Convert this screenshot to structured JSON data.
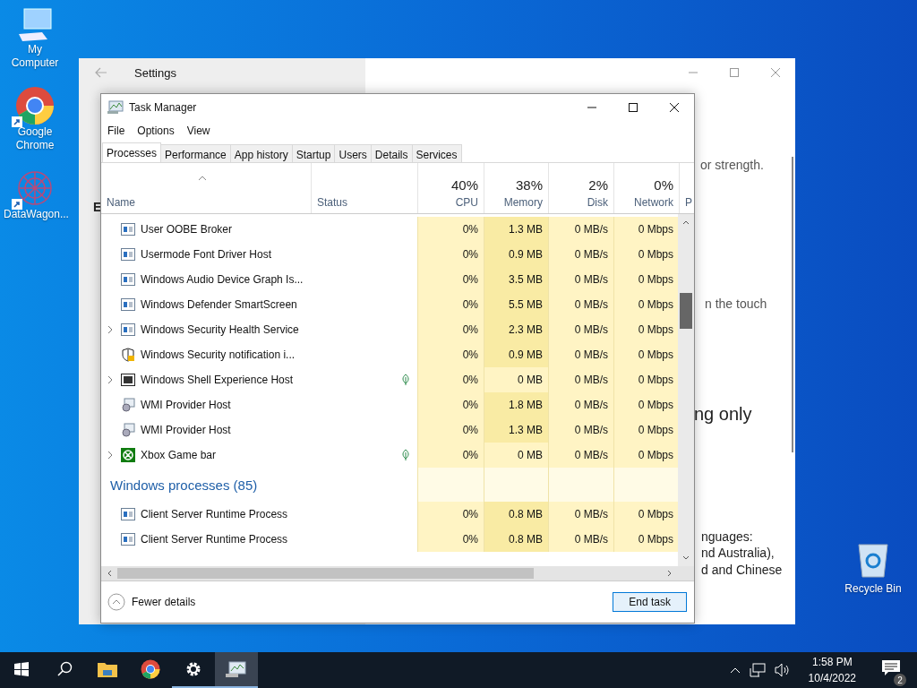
{
  "desktop_icons": [
    {
      "label": "My Computer",
      "kind": "computer",
      "shortcut": false
    },
    {
      "label": "Google Chrome",
      "kind": "chrome",
      "shortcut": true
    },
    {
      "label": "DataWagon...",
      "kind": "pattern",
      "shortcut": true
    }
  ],
  "recycle_bin": {
    "label": "Recycle Bin"
  },
  "settings_window": {
    "title": "Settings",
    "fragments": [
      "E",
      "or strength.",
      "n the touch",
      "ng only",
      "nguages:",
      "nd Australia),",
      "d and Chinese"
    ]
  },
  "task_manager": {
    "title": "Task Manager",
    "menu": [
      "File",
      "Options",
      "View"
    ],
    "tabs": [
      {
        "label": "Processes",
        "selected": true
      },
      {
        "label": "Performance",
        "selected": false
      },
      {
        "label": "App history",
        "selected": false
      },
      {
        "label": "Startup",
        "selected": false
      },
      {
        "label": "Users",
        "selected": false
      },
      {
        "label": "Details",
        "selected": false
      },
      {
        "label": "Services",
        "selected": false
      }
    ],
    "columns": [
      {
        "label": "Name"
      },
      {
        "label": "Status"
      },
      {
        "percent": "40%",
        "label": "CPU"
      },
      {
        "percent": "38%",
        "label": "Memory"
      },
      {
        "percent": "2%",
        "label": "Disk"
      },
      {
        "percent": "0%",
        "label": "Network"
      },
      {
        "label": "P"
      }
    ],
    "rows": [
      {
        "kind": "app",
        "expandable": false,
        "suspended": false,
        "name": "User OOBE Broker",
        "cpu": "0%",
        "memory": "1.3 MB",
        "disk": "0 MB/s",
        "network": "0 Mbps"
      },
      {
        "kind": "app",
        "expandable": false,
        "suspended": false,
        "name": "Usermode Font Driver Host",
        "cpu": "0%",
        "memory": "0.9 MB",
        "disk": "0 MB/s",
        "network": "0 Mbps"
      },
      {
        "kind": "app",
        "expandable": false,
        "suspended": false,
        "name": "Windows Audio Device Graph Is...",
        "cpu": "0%",
        "memory": "3.5 MB",
        "disk": "0 MB/s",
        "network": "0 Mbps"
      },
      {
        "kind": "app",
        "expandable": false,
        "suspended": false,
        "name": "Windows Defender SmartScreen",
        "cpu": "0%",
        "memory": "5.5 MB",
        "disk": "0 MB/s",
        "network": "0 Mbps"
      },
      {
        "kind": "app",
        "expandable": true,
        "suspended": false,
        "name": "Windows Security Health Service",
        "cpu": "0%",
        "memory": "2.3 MB",
        "disk": "0 MB/s",
        "network": "0 Mbps"
      },
      {
        "kind": "shield",
        "expandable": false,
        "suspended": false,
        "name": "Windows Security notification i...",
        "cpu": "0%",
        "memory": "0.9 MB",
        "disk": "0 MB/s",
        "network": "0 Mbps"
      },
      {
        "kind": "shell",
        "expandable": true,
        "suspended": true,
        "name": "Windows Shell Experience Host",
        "cpu": "0%",
        "memory": "0 MB",
        "disk": "0 MB/s",
        "network": "0 Mbps"
      },
      {
        "kind": "wmi",
        "expandable": false,
        "suspended": false,
        "name": "WMI Provider Host",
        "cpu": "0%",
        "memory": "1.8 MB",
        "disk": "0 MB/s",
        "network": "0 Mbps"
      },
      {
        "kind": "wmi",
        "expandable": false,
        "suspended": false,
        "name": "WMI Provider Host",
        "cpu": "0%",
        "memory": "1.3 MB",
        "disk": "0 MB/s",
        "network": "0 Mbps"
      },
      {
        "kind": "xbox",
        "expandable": true,
        "suspended": true,
        "name": "Xbox Game bar",
        "cpu": "0%",
        "memory": "0 MB",
        "disk": "0 MB/s",
        "network": "0 Mbps"
      },
      {
        "kind": "group",
        "name": "Windows processes (85)"
      },
      {
        "kind": "app",
        "expandable": false,
        "suspended": false,
        "name": "Client Server Runtime Process",
        "cpu": "0%",
        "memory": "0.8 MB",
        "disk": "0 MB/s",
        "network": "0 Mbps"
      },
      {
        "kind": "app",
        "expandable": false,
        "suspended": false,
        "name": "Client Server Runtime Process",
        "cpu": "0%",
        "memory": "0.8 MB",
        "disk": "0 MB/s",
        "network": "0 Mbps"
      }
    ],
    "footer": {
      "toggle": "Fewer details",
      "button": "End task"
    }
  },
  "taskbar": {
    "apps": [
      {
        "kind": "start",
        "running": false,
        "selected": false
      },
      {
        "kind": "search",
        "running": false,
        "selected": false
      },
      {
        "kind": "explorer",
        "running": false,
        "selected": false
      },
      {
        "kind": "chrome",
        "running": false,
        "selected": false
      },
      {
        "kind": "settings",
        "running": true,
        "selected": false
      },
      {
        "kind": "taskmanager",
        "running": true,
        "selected": true
      }
    ],
    "time": "1:58 PM",
    "date": "10/4/2022",
    "notifications": "2"
  }
}
